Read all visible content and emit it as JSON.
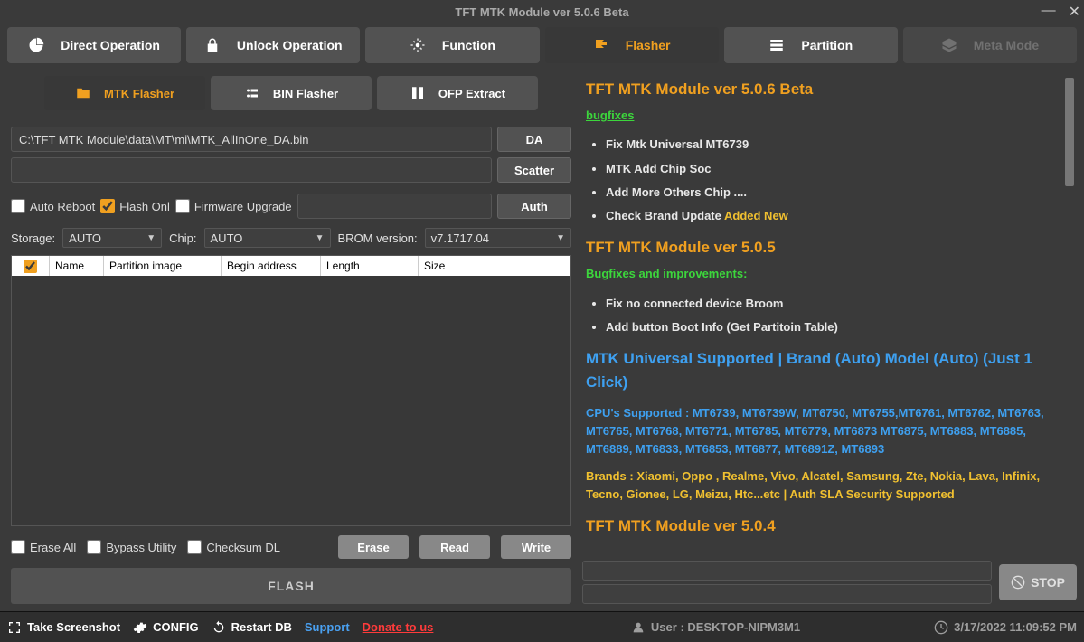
{
  "window": {
    "title": "TFT MTK Module ver 5.0.6 Beta"
  },
  "topTabs": {
    "direct": "Direct Operation",
    "unlock": "Unlock Operation",
    "function": "Function",
    "flasher": "Flasher",
    "partition": "Partition",
    "meta": "Meta Mode"
  },
  "subTabs": {
    "mtk": "MTK Flasher",
    "bin": "BIN Flasher",
    "ofp": "OFP Extract"
  },
  "paths": {
    "da": "C:\\TFT MTK Module\\data\\MT\\mi\\MTK_AllInOne_DA.bin",
    "daBtn": "DA",
    "scatterBtn": "Scatter",
    "authBtn": "Auth"
  },
  "options": {
    "autoReboot": "Auto Reboot",
    "flashOnly": "Flash Onl",
    "firmwareUpgrade": "Firmware Upgrade"
  },
  "storage": {
    "label": "Storage:",
    "value": "AUTO",
    "chipLabel": "Chip:",
    "chipValue": "AUTO",
    "bromLabel": "BROM version:",
    "bromValue": "v7.1717.04"
  },
  "columns": {
    "name": "Name",
    "partImg": "Partition image",
    "begin": "Begin address",
    "length": "Length",
    "size": "Size"
  },
  "bottom": {
    "eraseAll": "Erase All",
    "bypass": "Bypass Utility",
    "checksum": "Checksum DL",
    "erase": "Erase",
    "read": "Read",
    "write": "Write",
    "flash": "FLASH"
  },
  "changelog": {
    "h1": "TFT MTK Module ver 5.0.6 Beta",
    "bugfixes": "bugfixes",
    "b1": [
      "Fix Mtk Universal MT6739",
      "MTK Add Chip Soc",
      "Add More Others Chip ....",
      "Check Brand Update"
    ],
    "addedNew": " Added New",
    "h2": "TFT MTK Module ver 5.0.5",
    "bugfixes2": "Bugfixes and improvements:",
    "b2": [
      "Fix no connected device Broom",
      "Add button Boot Info (Get Partitoin Table)"
    ],
    "h3": "MTK Universal Supported | Brand (Auto) Model (Auto) (Just 1 Click)",
    "cpu": "CPU's Supported : MT6739, MT6739W, MT6750, MT6755,MT6761, MT6762, MT6763, MT6765, MT6768, MT6771, MT6785, MT6779, MT6873 MT6875, MT6883, MT6885, MT6889, MT6833, MT6853, MT6877, MT6891Z, MT6893",
    "brands": "Brands : Xiaomi, Oppo , Realme, Vivo, Alcatel, Samsung, Zte, Nokia, Lava, Infinix, Tecno, Gionee, LG, Meizu, Htc...etc | Auth SLA Security Supported",
    "h4": "TFT MTK Module ver 5.0.4"
  },
  "stop": {
    "label": "STOP"
  },
  "status": {
    "screenshot": "Take Screenshot",
    "config": "CONFIG",
    "restart": "Restart DB",
    "support": "Support",
    "donate": "Donate to us",
    "userLabel": "User : DESKTOP-NIPM3M1",
    "datetime": "3/17/2022 11:09:52 PM"
  }
}
